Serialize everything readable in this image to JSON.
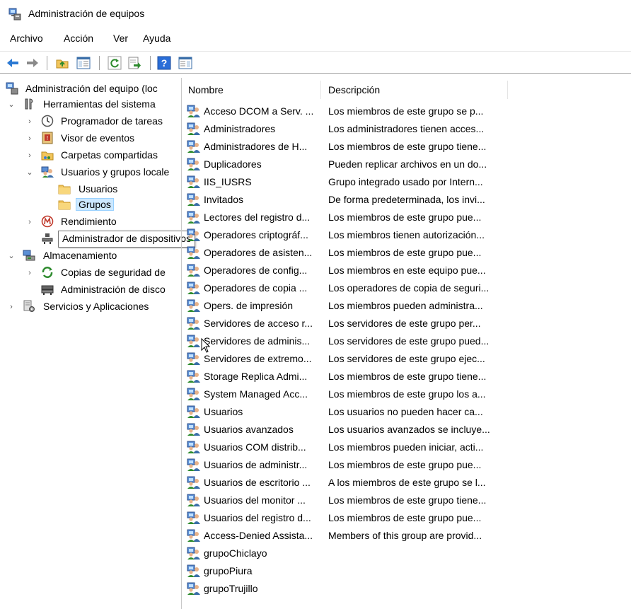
{
  "window": {
    "title": "Administración de equipos",
    "icon": "computer-management-icon"
  },
  "menu": [
    "Archivo",
    "Acción",
    "Ver",
    "Ayuda"
  ],
  "toolbar": {
    "buttons": [
      "back-arrow-icon",
      "forward-arrow-icon",
      "up-folder-icon",
      "show-hide-console-tree-icon",
      "refresh-icon",
      "export-list-icon",
      "help-icon",
      "show-hide-action-pane-icon"
    ]
  },
  "tree": {
    "items": [
      {
        "label": "Administración del equipo (loc",
        "icon": "computer-management-icon",
        "chevron": ""
      },
      {
        "label": "Herramientas del sistema",
        "icon": "tools-icon",
        "chevron": "expanded"
      },
      {
        "label": "Programador de tareas",
        "icon": "clock-icon",
        "chevron": "collapsed"
      },
      {
        "label": "Visor de eventos",
        "icon": "event-viewer-icon",
        "chevron": "collapsed"
      },
      {
        "label": "Carpetas compartidas",
        "icon": "shared-folder-icon",
        "chevron": "collapsed"
      },
      {
        "label": "Usuarios y grupos locale",
        "icon": "users-groups-icon",
        "chevron": "expanded"
      },
      {
        "label": "Usuarios",
        "icon": "folder-icon",
        "chevron": ""
      },
      {
        "label": "Grupos",
        "icon": "folder-icon",
        "chevron": "",
        "selected": true
      },
      {
        "label": "Rendimiento",
        "icon": "performance-icon",
        "chevron": "collapsed"
      },
      {
        "label": "Administrador de dispositivos",
        "icon": "device-manager-icon",
        "chevron": ""
      },
      {
        "label": "Almacenamiento",
        "icon": "storage-icon",
        "chevron": "expanded"
      },
      {
        "label": "Copias de seguridad de",
        "icon": "backup-icon",
        "chevron": "collapsed"
      },
      {
        "label": "Administración de disco",
        "icon": "disk-icon",
        "chevron": ""
      },
      {
        "label": "Servicios y Aplicaciones",
        "icon": "services-icon",
        "chevron": "collapsed"
      }
    ]
  },
  "tooltip": "Administrador de dispositivos",
  "list": {
    "columns": [
      "Nombre",
      "Descripción"
    ],
    "rows": [
      {
        "name": "Acceso DCOM a Serv. ...",
        "desc": "Los miembros de este grupo se p..."
      },
      {
        "name": "Administradores",
        "desc": "Los administradores tienen acces..."
      },
      {
        "name": "Administradores de H...",
        "desc": "Los miembros de este grupo tiene..."
      },
      {
        "name": "Duplicadores",
        "desc": "Pueden replicar archivos en un do..."
      },
      {
        "name": "IIS_IUSRS",
        "desc": "Grupo integrado usado por Intern..."
      },
      {
        "name": "Invitados",
        "desc": "De forma predeterminada, los invi..."
      },
      {
        "name": "Lectores del registro d...",
        "desc": "Los miembros de este grupo pue..."
      },
      {
        "name": "Operadores criptográf...",
        "desc": "Los miembros tienen autorización..."
      },
      {
        "name": "Operadores de asisten...",
        "desc": "Los miembros de este grupo pue..."
      },
      {
        "name": "Operadores de config...",
        "desc": "Los miembros en este equipo pue..."
      },
      {
        "name": "Operadores de copia ...",
        "desc": "Los operadores de copia de seguri..."
      },
      {
        "name": "Opers. de impresión",
        "desc": "Los miembros pueden administra..."
      },
      {
        "name": "Servidores de acceso r...",
        "desc": "Los servidores de este grupo per..."
      },
      {
        "name": "Servidores de adminis...",
        "desc": "Los servidores de este grupo pued..."
      },
      {
        "name": "Servidores de extremo...",
        "desc": "Los servidores de este grupo ejec..."
      },
      {
        "name": "Storage Replica Admi...",
        "desc": "Los miembros de este grupo tiene..."
      },
      {
        "name": "System Managed Acc...",
        "desc": "Los miembros de este grupo los a..."
      },
      {
        "name": "Usuarios",
        "desc": "Los usuarios no pueden hacer ca..."
      },
      {
        "name": "Usuarios avanzados",
        "desc": "Los usuarios avanzados se incluye..."
      },
      {
        "name": "Usuarios COM distrib...",
        "desc": "Los miembros pueden iniciar, acti..."
      },
      {
        "name": "Usuarios de administr...",
        "desc": "Los miembros de este grupo pue..."
      },
      {
        "name": "Usuarios de escritorio ...",
        "desc": "A los miembros de este grupo se l..."
      },
      {
        "name": "Usuarios del monitor ...",
        "desc": "Los miembros de este grupo tiene..."
      },
      {
        "name": "Usuarios del registro d...",
        "desc": "Los miembros de este grupo pue..."
      },
      {
        "name": "Access-Denied Assista...",
        "desc": "Members of this group are provid..."
      },
      {
        "name": "grupoChiclayo",
        "desc": ""
      },
      {
        "name": "grupoPiura",
        "desc": ""
      },
      {
        "name": "grupoTrujillo",
        "desc": ""
      }
    ]
  },
  "colors": {
    "selection_bg": "#cce8ff",
    "selection_border": "#99d1ff",
    "folder": "#f2c55c",
    "help_blue": "#2a6ed8",
    "back_arrow": "#2b79d3"
  }
}
